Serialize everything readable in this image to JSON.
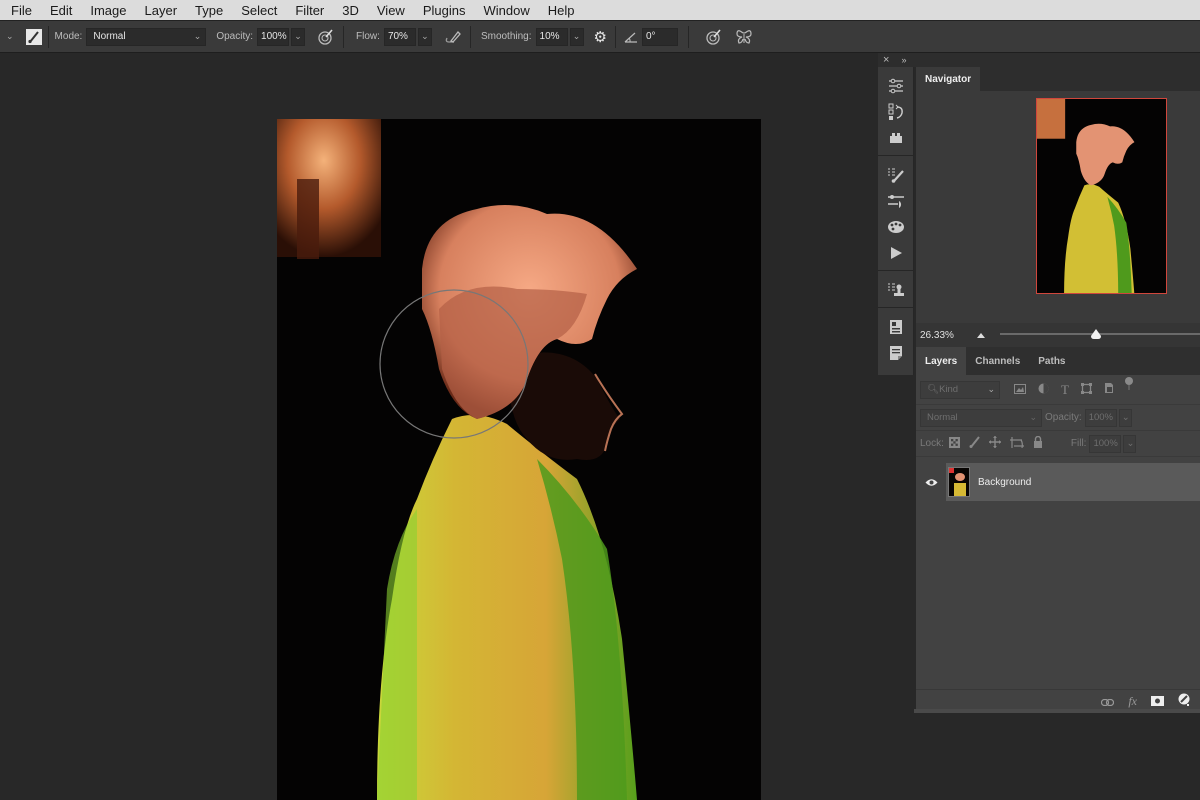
{
  "menubar": {
    "items": [
      "File",
      "Edit",
      "Image",
      "Layer",
      "Type",
      "Select",
      "Filter",
      "3D",
      "View",
      "Plugins",
      "Window",
      "Help"
    ]
  },
  "options_bar": {
    "mode_label": "Mode:",
    "mode_value": "Normal",
    "opacity_label": "Opacity:",
    "opacity_value": "100%",
    "flow_label": "Flow:",
    "flow_value": "70%",
    "smoothing_label": "Smoothing:",
    "smoothing_value": "10%",
    "angle_value": "0°",
    "icons": [
      "tool-preset-chevron-icon",
      "brush-tool-icon",
      "pressure-opacity-icon",
      "airbrush-icon",
      "smoothing-settings-gear-icon",
      "angle-icon",
      "pressure-size-icon",
      "symmetry-butterfly-icon"
    ]
  },
  "canvas": {
    "image_description": "Portrait of a person in profile with bleached curly hair and a yellow-green jacket against a dark background",
    "brush_cursor": "circle-brush-cursor"
  },
  "dock": {
    "close_label": "×",
    "collapse_label": "»",
    "strip_icons": [
      "properties-icon",
      "history-icon",
      "plugins-icon",
      "brush-settings-icon",
      "adjustments-icon",
      "swatches-icon",
      "actions-play-icon",
      "clone-source-icon",
      "libraries-icon",
      "notes-icon"
    ]
  },
  "navigator": {
    "tab_label": "Navigator",
    "zoom_value": "26.33%",
    "zoom_slider_fraction": 0.48,
    "view_box_color": "#d0463c"
  },
  "layers": {
    "tabs": [
      "Layers",
      "Channels",
      "Paths"
    ],
    "active_tab": "Layers",
    "filter_kind": "Kind",
    "blend_mode": "Normal",
    "opacity_label": "Opacity:",
    "opacity_value": "100%",
    "lock_label": "Lock:",
    "fill_label": "Fill:",
    "fill_value": "100%",
    "layer_list": [
      {
        "name": "Background",
        "visible": true,
        "selected": true
      }
    ],
    "footer_icons": [
      "link-layers-icon",
      "fx-icon",
      "add-mask-icon",
      "adjustment-layer-icon"
    ],
    "fx_label": "fx"
  }
}
